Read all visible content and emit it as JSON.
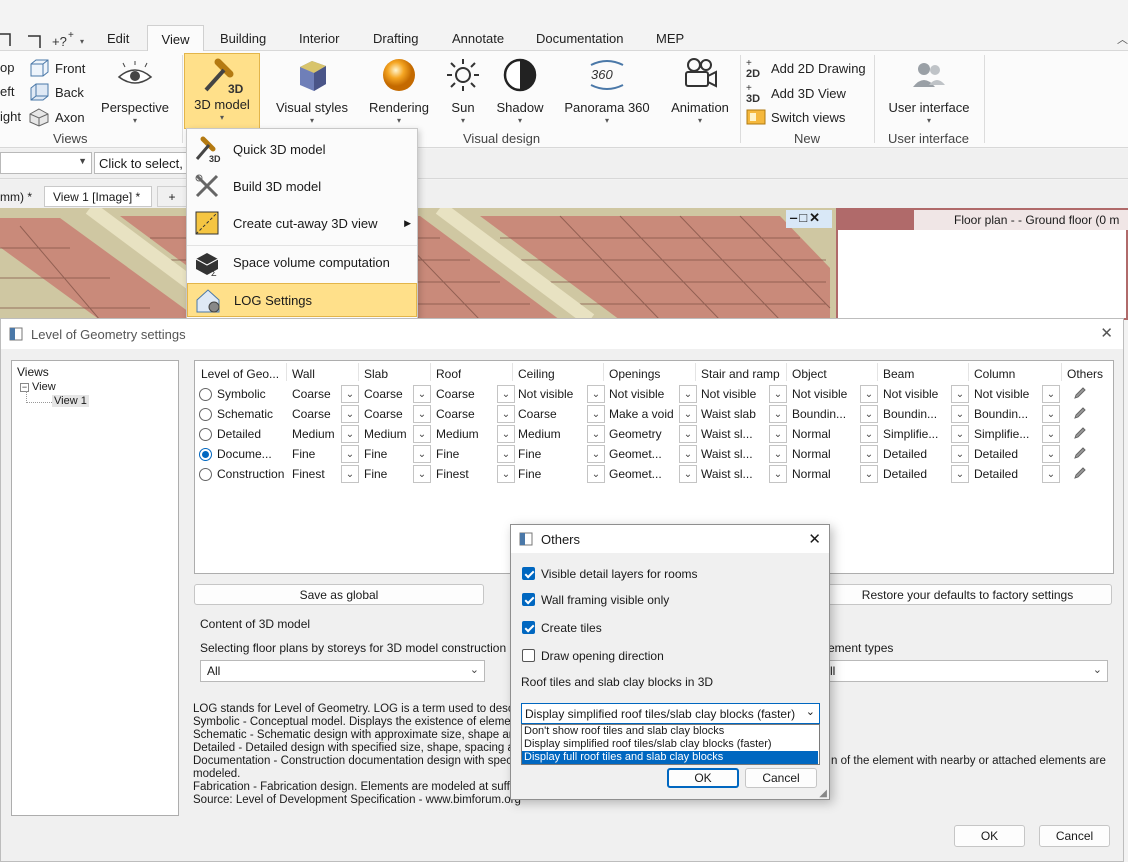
{
  "ribbon": {
    "tabs": [
      "Edit",
      "Building",
      "Interior",
      "Drafting",
      "Annotate",
      "Documentation",
      "MEP"
    ],
    "active_tab": "View",
    "left_items": [
      "op",
      "eft",
      "ight"
    ],
    "front": "Front",
    "back": "Back",
    "axon": "Axon",
    "perspective": "Perspective",
    "model3d": "3D model",
    "visual_styles": "Visual styles",
    "rendering": "Rendering",
    "sun": "Sun",
    "shadow": "Shadow",
    "panorama": "Panorama 360",
    "animation": "Animation",
    "add2d": "Add 2D Drawing",
    "add3d": "Add 3D View",
    "switch_views": "Switch views",
    "user_interface": "User interface",
    "groups": {
      "views": "Views",
      "visual_design": "Visual design",
      "new": "New",
      "user_interface": "User interface"
    },
    "icon_2d": "2D",
    "icon_3d": "3D",
    "icon_360": "360"
  },
  "cmdbar": {
    "hint": "Click to select, p"
  },
  "viewtabs": {
    "tab1": "mm) *",
    "tab2": "View 1 [Image] *",
    "add": "+"
  },
  "floorplan": {
    "title": "Floor plan -  - Ground floor (0 m"
  },
  "menu": {
    "items": [
      "Quick 3D model",
      "Build 3D model",
      "Create cut-away 3D view",
      "Space volume computation",
      "LOG Settings"
    ]
  },
  "log": {
    "title": "Level of Geometry settings",
    "views_label": "Views",
    "tree": [
      "View",
      "View 1"
    ],
    "headers": [
      "Level of Geo...",
      "Wall",
      "Slab",
      "Roof",
      "Ceiling",
      "Openings",
      "Stair and ramp",
      "Object",
      "Beam",
      "Column",
      "Others"
    ],
    "rows": [
      {
        "name": "Symbolic",
        "cells": [
          "Coarse",
          "Coarse",
          "Coarse",
          "Not visible",
          "Not visible",
          "Not visible",
          "Not visible",
          "Not visible",
          "Not visible"
        ]
      },
      {
        "name": "Schematic",
        "cells": [
          "Coarse",
          "Coarse",
          "Coarse",
          "Coarse",
          "Make a void",
          "Waist slab",
          "Boundin...",
          "Boundin...",
          "Boundin..."
        ]
      },
      {
        "name": "Detailed",
        "cells": [
          "Medium",
          "Medium",
          "Medium",
          "Medium",
          "Geometry",
          "Waist sl...",
          "Normal",
          "Simplifie...",
          "Simplifie..."
        ]
      },
      {
        "name": "Docume...",
        "cells": [
          "Fine",
          "Fine",
          "Fine",
          "Fine",
          "Geomet...",
          "Waist sl...",
          "Normal",
          "Detailed",
          "Detailed"
        ]
      },
      {
        "name": "Construction",
        "cells": [
          "Finest",
          "Fine",
          "Finest",
          "Fine",
          "Geomet...",
          "Waist sl...",
          "Normal",
          "Detailed",
          "Detailed"
        ]
      }
    ],
    "selected_row": 3,
    "save_global": "Save as global",
    "restore": "Restore your defaults to factory settings",
    "content_label": "Content of 3D model",
    "floor_label": "Selecting floor plans by storeys for 3D model construction",
    "floor_value": "All",
    "types_label": "ement types",
    "types_value": "ll",
    "desc": [
      "LOG stands for Level of Geometry. LOG is a term used to describe",
      "Symbolic -   Conceptual model. Displays the existence of elements",
      "Schematic - Schematic design with approximate size, shape and loc",
      "Detailed -    Detailed design with specified size, shape, spacing and",
      "Documentation - Construction documentation design with specified",
      "modeled.",
      "Fabrication - Fabrication design. Elements are modeled at sufficien",
      "Source: Level of Development Specification - www.bimforum.org"
    ],
    "desc_right": "n of the element with nearby or attached elements are",
    "ok": "OK",
    "cancel": "Cancel"
  },
  "others": {
    "title": "Others",
    "checks": [
      {
        "label": "Visible detail layers for rooms",
        "checked": true
      },
      {
        "label": "Wall framing visible only",
        "checked": true
      },
      {
        "label": "Create tiles",
        "checked": true
      },
      {
        "label": "Draw opening direction",
        "checked": false
      }
    ],
    "roof_label": "Roof tiles and slab clay blocks in 3D",
    "combo_value": "Display simplified roof tiles/slab clay blocks (faster)",
    "options": [
      "Don't show roof tiles and slab clay blocks",
      "Display simplified roof tiles/slab clay blocks (faster)",
      "Display full roof tiles and slab clay blocks"
    ],
    "highlighted_option": 2,
    "ok": "OK",
    "cancel": "Cancel"
  },
  "colors": {
    "accent": "#0067c0",
    "highlight": "#ffe08a",
    "roof": "#c98a7a",
    "ground": "#cfc7a2"
  }
}
